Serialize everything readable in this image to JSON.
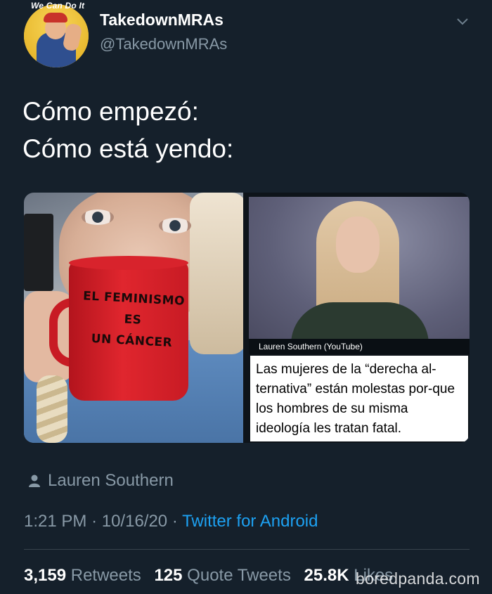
{
  "avatar": {
    "caption": "We Can Do It"
  },
  "user": {
    "display_name": "TakedownMRAs",
    "handle": "@TakedownMRAs"
  },
  "tweet": {
    "line1": "Cómo empezó:",
    "line2": "Cómo está yendo:"
  },
  "media": {
    "mug_line1": "EL FEMINISMO",
    "mug_line2": "ES",
    "mug_line3": "UN CÁNCER",
    "video_caption": "Lauren Southern (YouTube)",
    "news_text": "Las mujeres de la “derecha al-ternativa” están molestas por-que los hombres de su misma ideología les tratan fatal."
  },
  "tagged": {
    "name": "Lauren Southern"
  },
  "meta": {
    "time": "1:21 PM",
    "date": "10/16/20",
    "separator": "·",
    "source": "Twitter for Android"
  },
  "stats": {
    "retweets_count": "3,159",
    "retweets_label": "Retweets",
    "quotes_count": "125",
    "quotes_label": "Quote Tweets",
    "likes_count": "25.8K",
    "likes_label": "Likes"
  },
  "watermark": "boredpanda.com",
  "icons": {
    "chevron": "chevron-down-icon",
    "person": "person-icon"
  },
  "colors": {
    "background": "#15202b",
    "link": "#1da1f2",
    "secondary_text": "#8899a6",
    "mug_red": "#e0262e"
  }
}
